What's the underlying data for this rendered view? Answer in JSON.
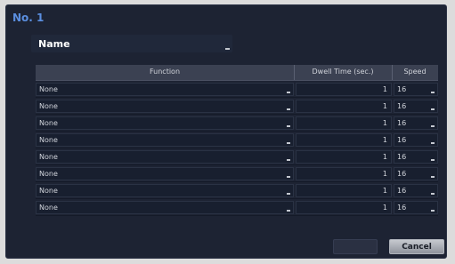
{
  "dialog": {
    "title": "No. 1",
    "name_label": "Name",
    "table": {
      "headers": {
        "function": "Function",
        "dwell_time": "Dwell Time (sec.)",
        "speed": "Speed"
      },
      "rows": [
        {
          "function": "None",
          "dwell_time": "1",
          "speed": "16"
        },
        {
          "function": "None",
          "dwell_time": "1",
          "speed": "16"
        },
        {
          "function": "None",
          "dwell_time": "1",
          "speed": "16"
        },
        {
          "function": "None",
          "dwell_time": "1",
          "speed": "16"
        },
        {
          "function": "None",
          "dwell_time": "1",
          "speed": "16"
        },
        {
          "function": "None",
          "dwell_time": "1",
          "speed": "16"
        },
        {
          "function": "None",
          "dwell_time": "1",
          "speed": "16"
        },
        {
          "function": "None",
          "dwell_time": "1",
          "speed": "16"
        }
      ]
    },
    "buttons": {
      "ok": "",
      "cancel": "Cancel"
    }
  }
}
